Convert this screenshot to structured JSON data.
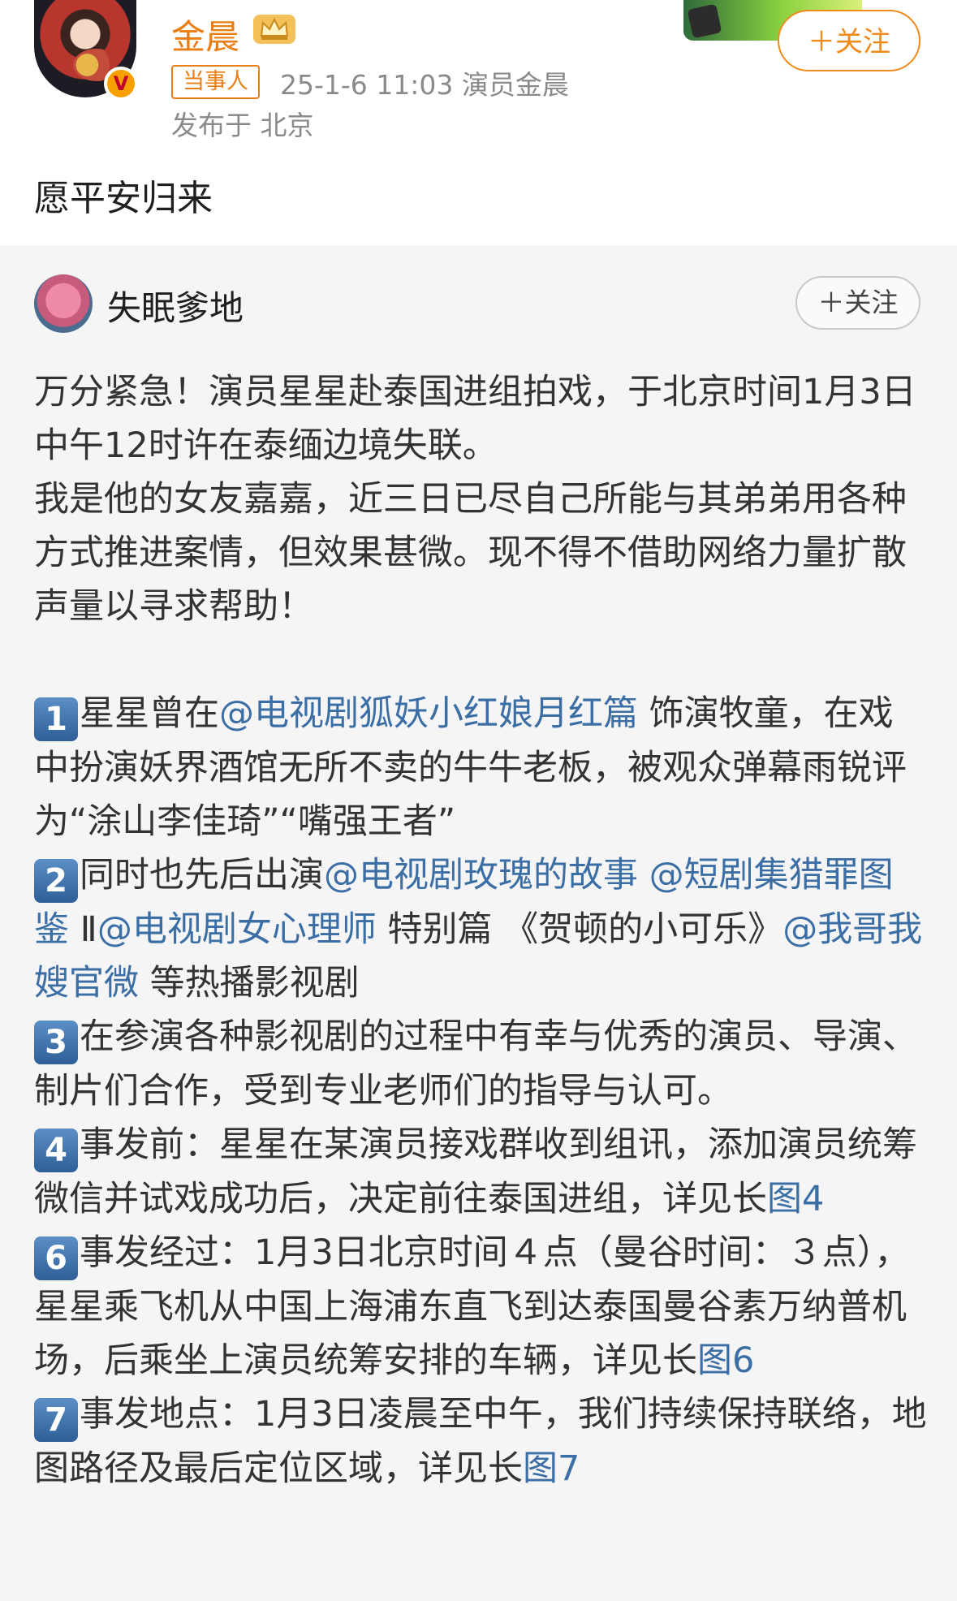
{
  "post": {
    "author": "金晨",
    "badge": "当事人",
    "meta": "25-1-6 11:03  演员金晨",
    "location": "发布于 北京",
    "follow_label": "＋关注",
    "text": "愿平安归来",
    "verified_mark": "V"
  },
  "repost": {
    "author": "失眠爹地",
    "follow_label": "＋关注",
    "intro": [
      "万分紧急！演员星星赴泰国进组拍戏，于北京时间1月3日中午12时许在泰缅边境失联。",
      "我是他的女友嘉嘉，近三日已尽自己所能与其弟弟用各种方式推进案情，但效果甚微。现不得不借助网络力量扩散声量以寻求帮助！"
    ],
    "items": [
      {
        "num": "1",
        "pre": "星星曾在",
        "link1": "@电视剧狐妖小红娘月红篇",
        "post": " 饰演牧童，在戏中扮演妖界酒馆无所不卖的牛牛老板，被观众弹幕雨锐评为“涂山李佳琦”“嘴强王者”"
      },
      {
        "num": "2",
        "pre": "同时也先后出演",
        "link1": "@电视剧玫瑰的故事",
        "mid1": " ",
        "link2": "@短剧集猎罪图鉴",
        "mid2": " Ⅱ",
        "link3": "@电视剧女心理师",
        "mid3": " 特别篇 《贺顿的小可乐》",
        "link4": "@我哥我嫂官微",
        "post": " 等热播影视剧"
      },
      {
        "num": "3",
        "text": "在参演各种影视剧的过程中有幸与优秀的演员、导演、制片们合作，受到专业老师们的指导与认可。"
      },
      {
        "num": "4",
        "text": "事发前：星星在某演员接戏群收到组讯，添加演员统筹微信并试戏成功后，决定前往泰国进组，详见长",
        "link": "图4"
      },
      {
        "num": "6",
        "text": "事发经过：1月3日北京时间４点（曼谷时间：３点），星星乘飞机从中国上海浦东直飞到达泰国曼谷素万纳普机场，后乘坐上演员统筹安排的车辆，详见长",
        "link": "图6"
      },
      {
        "num": "7",
        "text": "事发地点：1月3日凌晨至中午，我们持续保持联络，地图路径及最后定位区域，详见长",
        "link": "图7"
      }
    ]
  },
  "colors": {
    "accent_orange": "#ea7d13",
    "link_blue": "#3b6ea5",
    "repost_bg": "#f5f5f5"
  }
}
